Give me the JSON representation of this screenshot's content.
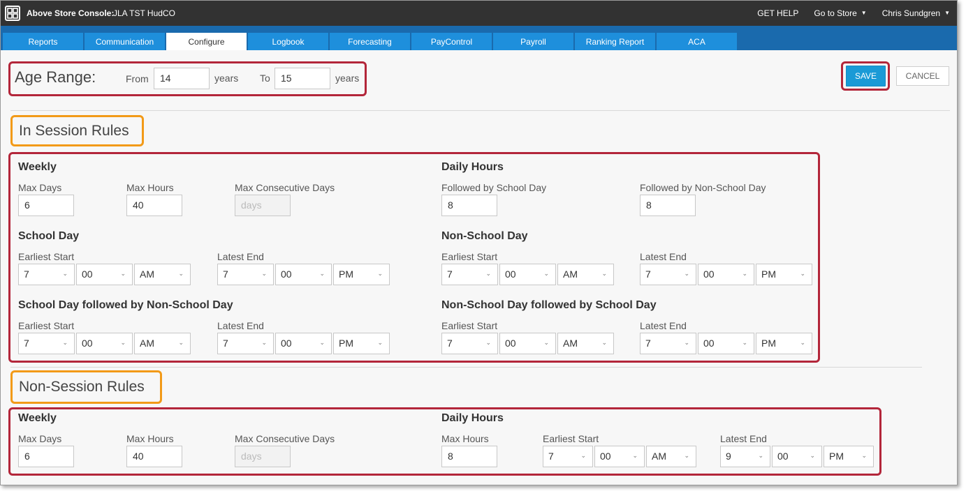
{
  "app": {
    "title": "Above Store Console:",
    "store": "JLA TST HudCO",
    "get_help": "GET HELP",
    "go_to_store": "Go to Store",
    "user": "Chris Sundgren"
  },
  "tabs": [
    "Reports",
    "Communication",
    "Configure",
    "Logbook",
    "Forecasting",
    "PayControl",
    "Payroll",
    "Ranking Report",
    "ACA"
  ],
  "active_tab": "Configure",
  "age_range": {
    "label": "Age Range:",
    "from_label": "From",
    "from_value": "14",
    "years1": "years",
    "to_label": "To",
    "to_value": "15",
    "years2": "years"
  },
  "buttons": {
    "save": "SAVE",
    "cancel": "CANCEL"
  },
  "in_session": {
    "title": "In Session Rules",
    "weekly": {
      "title": "Weekly",
      "max_days_label": "Max Days",
      "max_days": "6",
      "max_hours_label": "Max Hours",
      "max_hours": "40",
      "max_consec_label": "Max Consecutive Days",
      "max_consec_placeholder": "days"
    },
    "daily": {
      "title": "Daily Hours",
      "school_label": "Followed by School Day",
      "school_value": "8",
      "nonschool_label": "Followed by Non-School Day",
      "nonschool_value": "8"
    },
    "school_day": {
      "title": "School Day",
      "start_label": "Earliest Start",
      "start": [
        "7",
        "00",
        "AM"
      ],
      "end_label": "Latest End",
      "end": [
        "7",
        "00",
        "PM"
      ]
    },
    "non_school_day": {
      "title": "Non-School Day",
      "start_label": "Earliest Start",
      "start": [
        "7",
        "00",
        "AM"
      ],
      "end_label": "Latest End",
      "end": [
        "7",
        "00",
        "PM"
      ]
    },
    "school_then_non": {
      "title": "School Day followed by Non-School Day",
      "start_label": "Earliest Start",
      "start": [
        "7",
        "00",
        "AM"
      ],
      "end_label": "Latest End",
      "end": [
        "7",
        "00",
        "PM"
      ]
    },
    "non_then_school": {
      "title": "Non-School Day followed by School Day",
      "start_label": "Earliest Start",
      "start": [
        "7",
        "00",
        "AM"
      ],
      "end_label": "Latest End",
      "end": [
        "7",
        "00",
        "PM"
      ]
    }
  },
  "non_session": {
    "title": "Non-Session Rules",
    "weekly": {
      "title": "Weekly",
      "max_days_label": "Max Days",
      "max_days": "6",
      "max_hours_label": "Max Hours",
      "max_hours": "40",
      "max_consec_label": "Max Consecutive Days",
      "max_consec_placeholder": "days"
    },
    "daily": {
      "title": "Daily Hours",
      "max_hours_label": "Max Hours",
      "max_hours": "8",
      "start_label": "Earliest Start",
      "start": [
        "7",
        "00",
        "AM"
      ],
      "end_label": "Latest End",
      "end": [
        "9",
        "00",
        "PM"
      ]
    }
  },
  "colors": {
    "highlight_red": "#b3263a",
    "highlight_orange": "#f29a18",
    "save_blue": "#1a9ad6",
    "tab_blue": "#1e8fdc",
    "nav_blue": "#1a6aad"
  }
}
